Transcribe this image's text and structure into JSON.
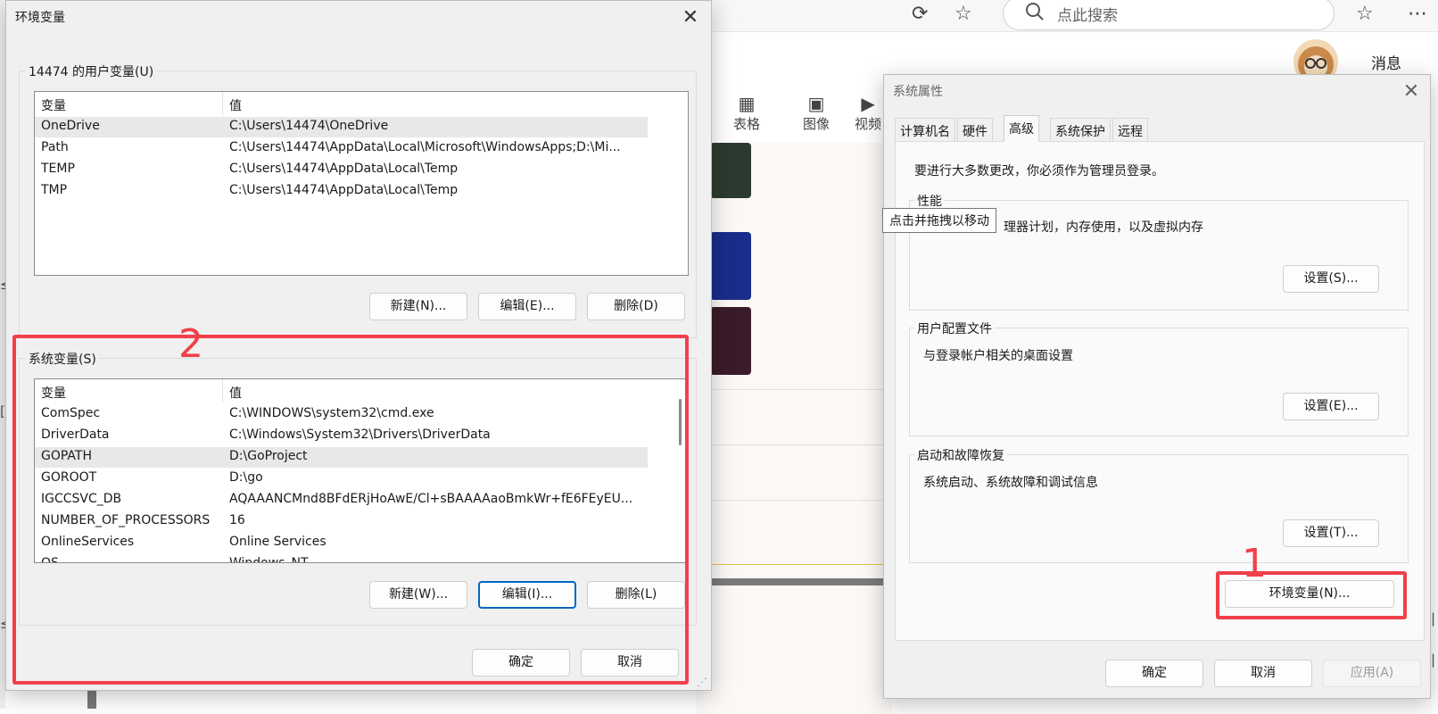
{
  "browser": {
    "search_placeholder": "点此搜索",
    "messages_label": "消息",
    "toolbar_items": [
      "表格",
      "图像",
      "视频"
    ]
  },
  "env_dialog": {
    "title": "环境变量",
    "user_group_label": "14474 的用户变量(U)",
    "columns": [
      "变量",
      "值"
    ],
    "user_vars": [
      {
        "name": "OneDrive",
        "value": "C:\\Users\\14474\\OneDrive"
      },
      {
        "name": "Path",
        "value": "C:\\Users\\14474\\AppData\\Local\\Microsoft\\WindowsApps;D:\\Mi..."
      },
      {
        "name": "TEMP",
        "value": "C:\\Users\\14474\\AppData\\Local\\Temp"
      },
      {
        "name": "TMP",
        "value": "C:\\Users\\14474\\AppData\\Local\\Temp"
      }
    ],
    "user_buttons": {
      "new": "新建(N)...",
      "edit": "编辑(E)...",
      "delete": "删除(D)"
    },
    "system_group_label": "系统变量(S)",
    "system_vars": [
      {
        "name": "ComSpec",
        "value": "C:\\WINDOWS\\system32\\cmd.exe"
      },
      {
        "name": "DriverData",
        "value": "C:\\Windows\\System32\\Drivers\\DriverData"
      },
      {
        "name": "GOPATH",
        "value": "D:\\GoProject"
      },
      {
        "name": "GOROOT",
        "value": "D:\\go"
      },
      {
        "name": "IGCCSVC_DB",
        "value": "AQAAANCMnd8BFdERjHoAwE/Cl+sBAAAAaoBmkWr+fE6FEyEU..."
      },
      {
        "name": "NUMBER_OF_PROCESSORS",
        "value": "16"
      },
      {
        "name": "OnlineServices",
        "value": "Online Services"
      },
      {
        "name": "OS",
        "value": "Windows_NT"
      }
    ],
    "system_buttons": {
      "new": "新建(W)...",
      "edit": "编辑(I)...",
      "delete": "删除(L)"
    },
    "ok": "确定",
    "cancel": "取消"
  },
  "sys_props": {
    "title": "系统属性",
    "tabs": [
      "计算机名",
      "硬件",
      "高级",
      "系统保护",
      "远程"
    ],
    "admin_note": "要进行大多数更改，你必须作为管理员登录。",
    "performance": {
      "label": "性能",
      "desc": "理器计划，内存使用，以及虚拟内存",
      "button": "设置(S)..."
    },
    "user_profiles": {
      "label": "用户配置文件",
      "desc": "与登录帐户相关的桌面设置",
      "button": "设置(E)..."
    },
    "startup": {
      "label": "启动和故障恢复",
      "desc": "系统启动、系统故障和调试信息",
      "button": "设置(T)..."
    },
    "env_button": "环境变量(N)...",
    "ok": "确定",
    "cancel": "取消",
    "apply": "应用(A)"
  },
  "tooltip": "点击并拖拽以移动",
  "annotations": {
    "one": "1",
    "two": "2"
  },
  "colors": {
    "annotation": "#f0404a",
    "focus": "#0067c0"
  }
}
